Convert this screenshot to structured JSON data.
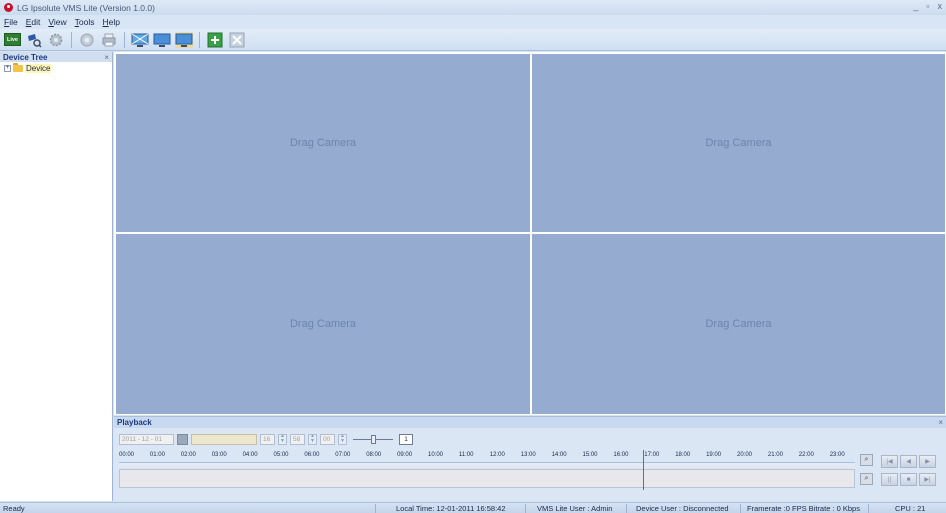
{
  "window": {
    "title": "LG Ipsolute VMS Lite (Version 1.0.0)",
    "controls": [
      "_",
      "▫",
      "x"
    ]
  },
  "menu": {
    "items": [
      "File",
      "Edit",
      "View",
      "Tools",
      "Help"
    ]
  },
  "toolbar": {
    "live_label": "Live",
    "buttons": [
      "live-view",
      "search-playback",
      "settings",
      "config",
      "print",
      "display-1",
      "display-2",
      "display-3",
      "add-device",
      "remove-device"
    ]
  },
  "device_tree": {
    "title": "Device Tree",
    "close": "×",
    "expander": "+",
    "root_label": "Device"
  },
  "video_grid": {
    "cells": [
      "Drag Camera",
      "Drag Camera",
      "Drag Camera",
      "Drag Camera"
    ]
  },
  "playback": {
    "title": "Playback",
    "close": "×",
    "date": "2011 - 12 - 01",
    "hour": "16",
    "minute": "58",
    "second": "00",
    "speed": "1",
    "speed_level": 0.5,
    "hours": [
      "00:00",
      "01:00",
      "02:00",
      "03:00",
      "04:00",
      "05:00",
      "06:00",
      "07:00",
      "08:00",
      "09:00",
      "10:00",
      "11:00",
      "12:00",
      "13:00",
      "14:00",
      "15:00",
      "16:00",
      "17:00",
      "18:00",
      "19:00",
      "20:00",
      "21:00",
      "22:00",
      "23:00"
    ],
    "cursor_time": "16:58"
  },
  "statusbar": {
    "ready": "Ready",
    "local_time": "Local Time: 12-01-2011 16:58:42",
    "vms_user": "VMS Lite User : Admin",
    "device_user": "Device User : Disconnected",
    "framerate": "Framerate :0 FPS  Bitrate : 0 Kbps",
    "cpu": "CPU : 21"
  },
  "colors": {
    "cell": "#95acd0",
    "accent": "#1a3a80",
    "cursor": "#e0403a",
    "live": "#2e7d32"
  }
}
